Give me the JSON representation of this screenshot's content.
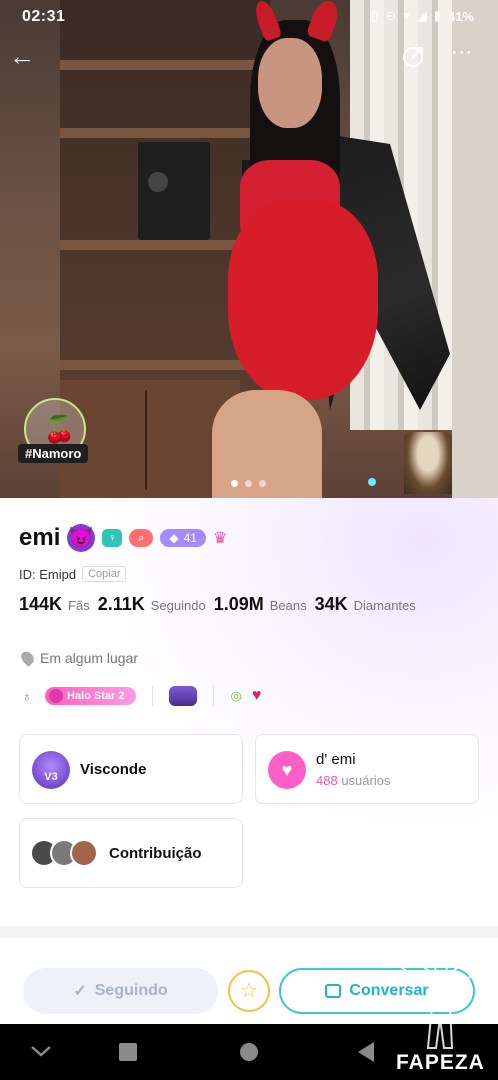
{
  "status_bar": {
    "time": "02:31",
    "battery": "41%",
    "icons": [
      "vibrate-icon",
      "dnd-icon",
      "wifi-icon",
      "signal-icon",
      "battery-icon"
    ]
  },
  "hero": {
    "tag_label": "#Namoro",
    "tag_icon": "cherry-icon",
    "photo_count": 3,
    "active_photo": 1
  },
  "profile": {
    "name": "emi",
    "name_emoji": "😈",
    "level_badge": "41",
    "id_label": "ID: Emipd",
    "copy_label": "Copiar",
    "stats": [
      {
        "value": "144K",
        "label": "Fãs"
      },
      {
        "value": "2.11K",
        "label": "Seguindo"
      },
      {
        "value": "1.09M",
        "label": "Beans"
      },
      {
        "value": "34K",
        "label": "Diamantes"
      }
    ],
    "location": "Em algum lugar",
    "halo_star": "Halo Star 2"
  },
  "cards": {
    "visconde": {
      "title": "Visconde",
      "icon_text": "V3"
    },
    "demi": {
      "title": "d' emi",
      "count": "488",
      "count_suffix": " usuários"
    },
    "contribution": {
      "title": "Contribuição",
      "avatar_badge": "3"
    }
  },
  "actions": {
    "following": "Seguindo",
    "chat": "Conversar"
  },
  "watermark": "FAPEZA",
  "colors": {
    "accent_cyan": "#38c8d8",
    "accent_pink": "#ff5ec8",
    "level_purple": "#a38aff",
    "star_gold": "#f5c242"
  }
}
